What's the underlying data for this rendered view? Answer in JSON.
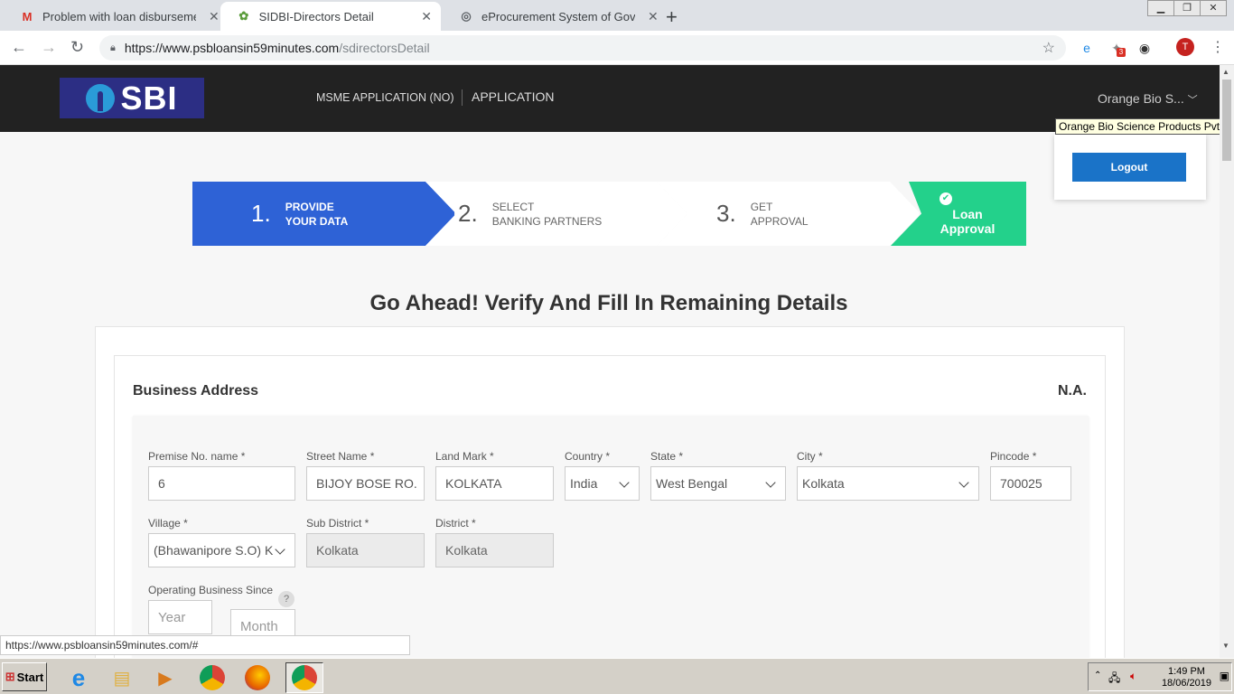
{
  "browser": {
    "tabs": [
      {
        "title": "Problem with loan disbursement",
        "favicon": "gmail-icon"
      },
      {
        "title": "SIDBI-Directors Detail",
        "favicon": "psb-icon"
      },
      {
        "title": "eProcurement System of Governm",
        "favicon": "globe-icon"
      }
    ],
    "url_host": "https://www.psbloansin59minutes.com",
    "url_path": "/sdirectorsDetail",
    "ext_badge": "3",
    "avatar_letter": "T",
    "status_url": "https://www.psbloansin59minutes.com/#"
  },
  "header": {
    "logo_text": "SBI",
    "nav_msme": "MSME APPLICATION (NO)",
    "nav_application": "APPLICATION",
    "user_short": "Orange Bio S...",
    "user_full": "Orange Bio Science Products Pvt Ltd",
    "logout_label": "Logout"
  },
  "steps": [
    {
      "num": "1.",
      "line1": "PROVIDE",
      "line2": "YOUR DATA"
    },
    {
      "num": "2.",
      "line1": "SELECT",
      "line2": "BANKING PARTNERS"
    },
    {
      "num": "3.",
      "line1": "GET",
      "line2": "APPROVAL"
    },
    {
      "line1": "Loan",
      "line2": "Approval"
    }
  ],
  "heading": "Go Ahead! Verify And Fill In Remaining Details",
  "business_address": {
    "title": "Business Address",
    "na": "N.A.",
    "fields": {
      "premise": {
        "label": "Premise No. name *",
        "value": "6"
      },
      "street": {
        "label": "Street Name *",
        "value": "BIJOY BOSE RO."
      },
      "landmark": {
        "label": "Land Mark *",
        "value": "KOLKATA"
      },
      "country": {
        "label": "Country *",
        "value": "India"
      },
      "state": {
        "label": "State *",
        "value": "West Bengal"
      },
      "city": {
        "label": "City *",
        "value": "Kolkata"
      },
      "pincode": {
        "label": "Pincode *",
        "value": "700025"
      },
      "village": {
        "label": "Village *",
        "value": "(Bhawanipore S.O) K"
      },
      "subdistrict": {
        "label": "Sub District *",
        "value": "Kolkata"
      },
      "district": {
        "label": "District *",
        "value": "Kolkata"
      },
      "since": {
        "label": "Operating Business Since",
        "year_placeholder": "Year",
        "month_placeholder": "Month",
        "help": "?"
      }
    }
  },
  "taskbar": {
    "start_label": "Start",
    "time": "1:49 PM",
    "date": "18/06/2019"
  }
}
